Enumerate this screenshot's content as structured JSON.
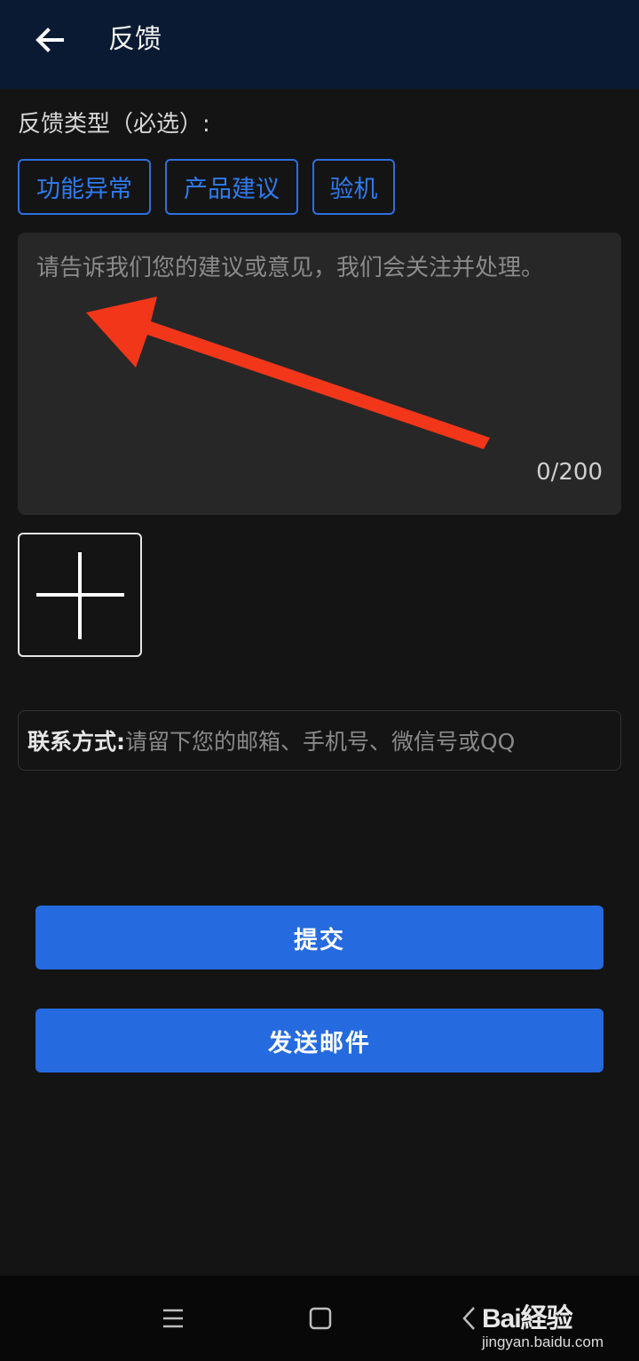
{
  "header": {
    "title": "反馈",
    "back_icon": "arrow-left-icon"
  },
  "feedback_type": {
    "label": "反馈类型（必选）:",
    "options": [
      "功能异常",
      "产品建议",
      "验机"
    ]
  },
  "feedback_input": {
    "placeholder": "请告诉我们您的建议或意见，我们会关注并处理。",
    "counter": "0/200"
  },
  "add_image": {
    "icon": "plus-icon"
  },
  "contact": {
    "label": "联系方式:",
    "placeholder": "请留下您的邮箱、手机号、微信号或QQ"
  },
  "actions": {
    "submit_label": "提交",
    "send_email_label": "发送邮件"
  },
  "navbar": {
    "menu_icon": "menu-icon",
    "home_icon": "home-square-icon",
    "back_icon": "chevron-left-icon"
  },
  "watermark": {
    "logo": "Bai経验",
    "url": "jingyan.baidu.com"
  },
  "colors": {
    "accent": "#256bdf",
    "header_bg": "#0a1a33",
    "page_bg": "#141414",
    "annotation_arrow": "#f2361a"
  }
}
